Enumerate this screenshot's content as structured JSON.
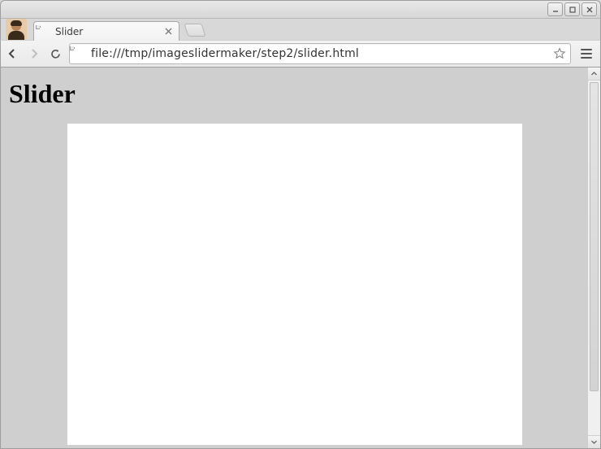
{
  "window": {
    "controls": {
      "minimize": "minimize",
      "maximize": "maximize",
      "close": "close"
    }
  },
  "tabs": [
    {
      "title": "Slider",
      "favicon": "file-icon"
    }
  ],
  "toolbar": {
    "back": "back",
    "forward": "forward",
    "reload": "reload",
    "url": "file:///tmp/imageslidermaker/step2/slider.html",
    "bookmark": "bookmark",
    "menu": "menu"
  },
  "page": {
    "heading": "Slider"
  }
}
